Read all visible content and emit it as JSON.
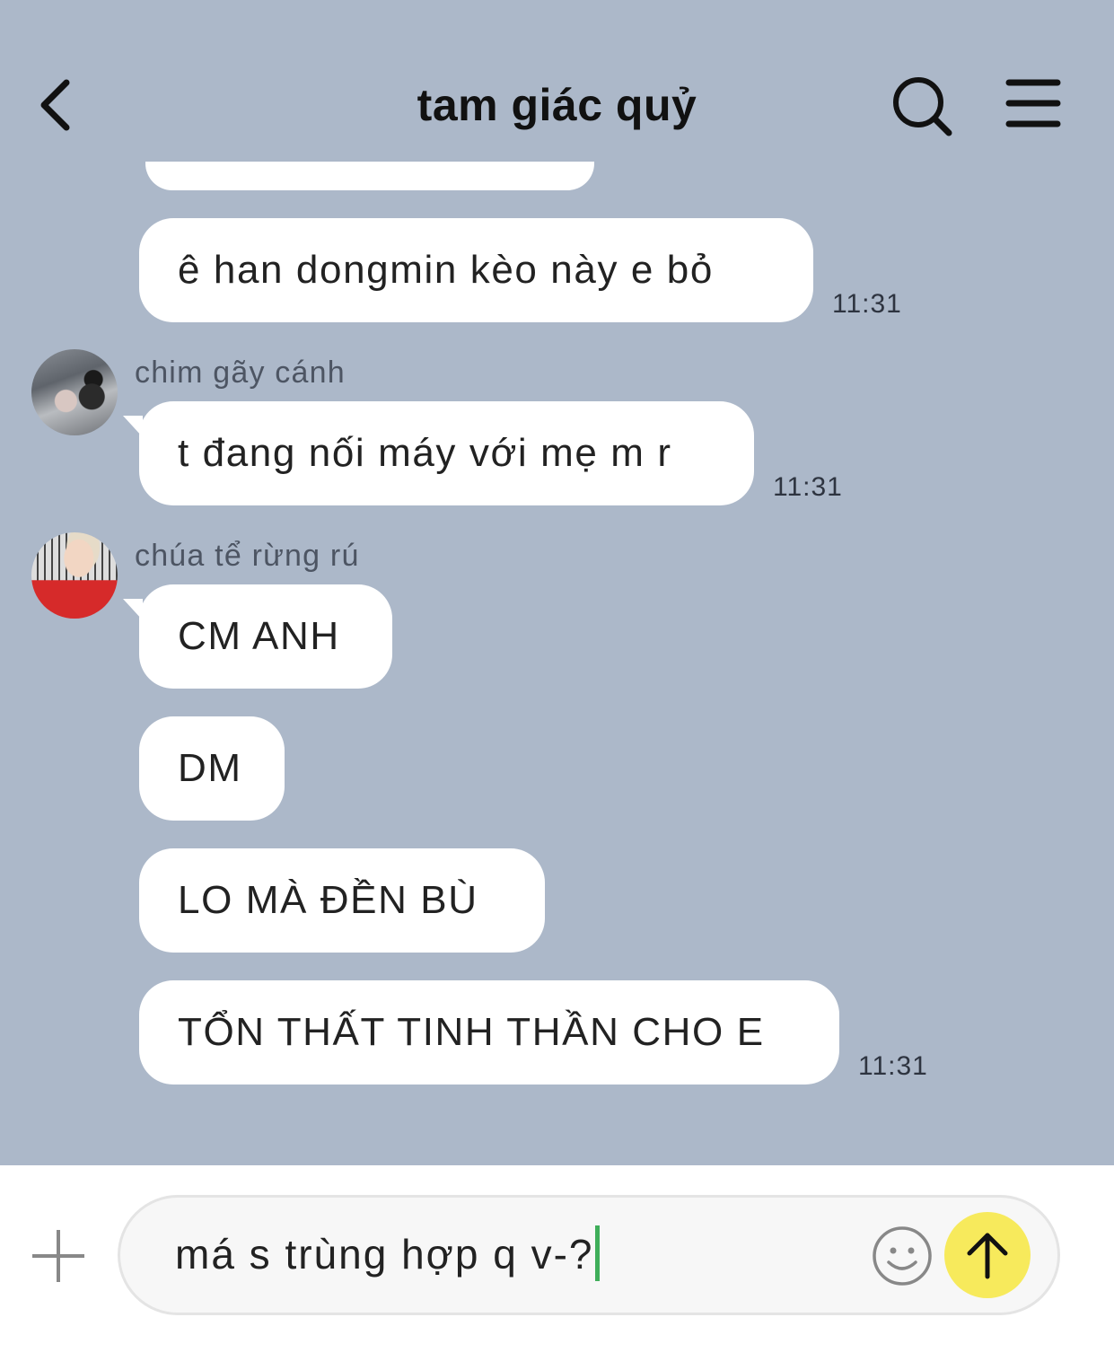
{
  "header": {
    "title": "tam giác quỷ",
    "back_icon": "chevron-left-icon",
    "search_icon": "search-icon",
    "menu_icon": "hamburger-menu-icon"
  },
  "messages": [
    {
      "text": "ê han dongmin kèo này e bỏ",
      "time": "11:31"
    },
    {
      "sender": "chim gãy cánh",
      "text": "t đang nối máy với mẹ m r",
      "time": "11:31"
    },
    {
      "sender": "chúa tể rừng rú",
      "text": "CM ANH"
    },
    {
      "text": "DM"
    },
    {
      "text": "LO MÀ ĐỀN BÙ"
    },
    {
      "text": "TỔN THẤT TINH THẦN CHO E",
      "time": "11:31"
    }
  ],
  "composer": {
    "value": "má s trùng hợp q v-?",
    "plus_icon": "plus-icon",
    "emoji_icon": "smiley-icon",
    "send_icon": "arrow-up-icon",
    "send_color": "#f7ea5c"
  },
  "colors": {
    "chat_background": "#acb8c9",
    "bubble": "#ffffff"
  }
}
